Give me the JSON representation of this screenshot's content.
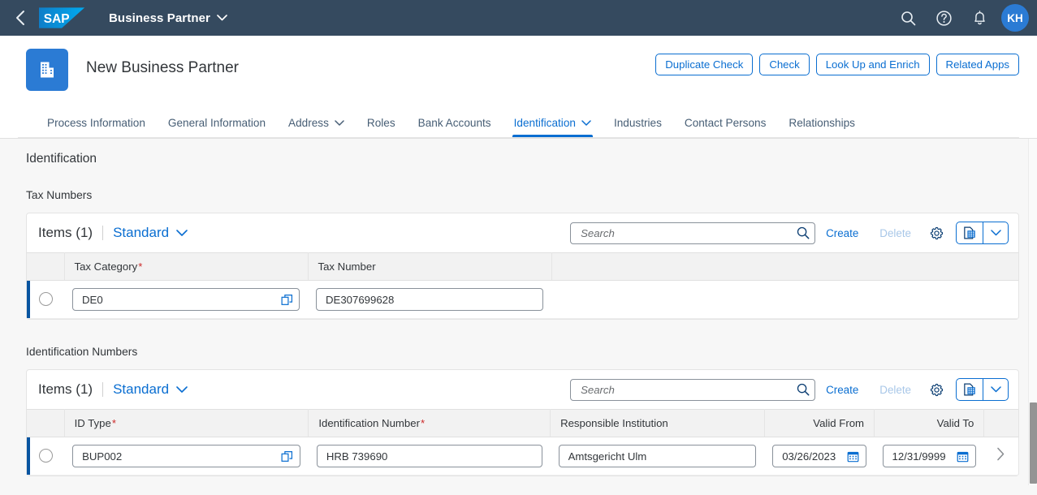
{
  "shellbar": {
    "back_icon": "chevron-left-icon",
    "logo_text": "SAP",
    "title": "Business Partner",
    "title_chevron": "chevron-down-icon",
    "search_icon": "search-icon",
    "help_icon": "question-mark-icon",
    "notifications_icon": "bell-icon",
    "avatar_initials": "KH",
    "colors": {
      "background": "#354a5f",
      "avatar": "#2b7bd4"
    }
  },
  "object_header": {
    "app_icon": "building-icon",
    "title": "New Business Partner",
    "actions": [
      {
        "label": "Duplicate Check"
      },
      {
        "label": "Check"
      },
      {
        "label": "Look Up and Enrich"
      },
      {
        "label": "Related Apps"
      }
    ],
    "colors": {
      "accent": "#0a6ed1",
      "tile": "#2b7bd4"
    }
  },
  "tabs": [
    {
      "label": "Process Information",
      "active": false,
      "has_chevron": false
    },
    {
      "label": "General Information",
      "active": false,
      "has_chevron": false
    },
    {
      "label": "Address",
      "active": false,
      "has_chevron": true
    },
    {
      "label": "Roles",
      "active": false,
      "has_chevron": false
    },
    {
      "label": "Bank Accounts",
      "active": false,
      "has_chevron": false
    },
    {
      "label": "Identification",
      "active": true,
      "has_chevron": true
    },
    {
      "label": "Industries",
      "active": false,
      "has_chevron": false
    },
    {
      "label": "Contact Persons",
      "active": false,
      "has_chevron": false
    },
    {
      "label": "Relationships",
      "active": false,
      "has_chevron": false
    }
  ],
  "content": {
    "section_title": "Identification",
    "tax_numbers": {
      "title": "Tax Numbers",
      "toolbar": {
        "items_count": "Items (1)",
        "variant": "Standard",
        "variant_chevron": "chevron-down-icon",
        "search_placeholder": "Search",
        "search_value": "",
        "search_icon": "search-icon",
        "create_label": "Create",
        "delete_label": "Delete",
        "delete_disabled": true,
        "settings_icon": "gear-icon",
        "export_icon": "export-to-spreadsheet-icon",
        "export_chevron": "chevron-down-icon"
      },
      "columns": [
        {
          "label": "Tax Category",
          "required": true,
          "align": "left"
        },
        {
          "label": "Tax Number",
          "required": false,
          "align": "left"
        }
      ],
      "rows": [
        {
          "selected": false,
          "tax_category": "DE0",
          "tax_category_help_icon": "value-help-icon",
          "tax_number": "DE307699628"
        }
      ]
    },
    "identification_numbers": {
      "title": "Identification Numbers",
      "toolbar": {
        "items_count": "Items (1)",
        "variant": "Standard",
        "variant_chevron": "chevron-down-icon",
        "search_placeholder": "Search",
        "search_value": "",
        "search_icon": "search-icon",
        "create_label": "Create",
        "delete_label": "Delete",
        "delete_disabled": true,
        "settings_icon": "gear-icon",
        "export_icon": "export-to-spreadsheet-icon",
        "export_chevron": "chevron-down-icon"
      },
      "columns": [
        {
          "label": "ID Type",
          "required": true,
          "align": "left"
        },
        {
          "label": "Identification Number",
          "required": true,
          "align": "left"
        },
        {
          "label": "Responsible Institution",
          "required": false,
          "align": "left"
        },
        {
          "label": "Valid From",
          "required": false,
          "align": "right"
        },
        {
          "label": "Valid To",
          "required": false,
          "align": "right"
        }
      ],
      "rows": [
        {
          "selected": false,
          "id_type": "BUP002",
          "id_type_help_icon": "value-help-icon",
          "identification_number": "HRB 739690",
          "responsible_institution": "Amtsgericht Ulm",
          "valid_from": "03/26/2023",
          "valid_from_icon": "calendar-icon",
          "valid_to": "12/31/9999",
          "valid_to_icon": "calendar-icon",
          "nav_icon": "chevron-right-icon"
        }
      ]
    }
  }
}
